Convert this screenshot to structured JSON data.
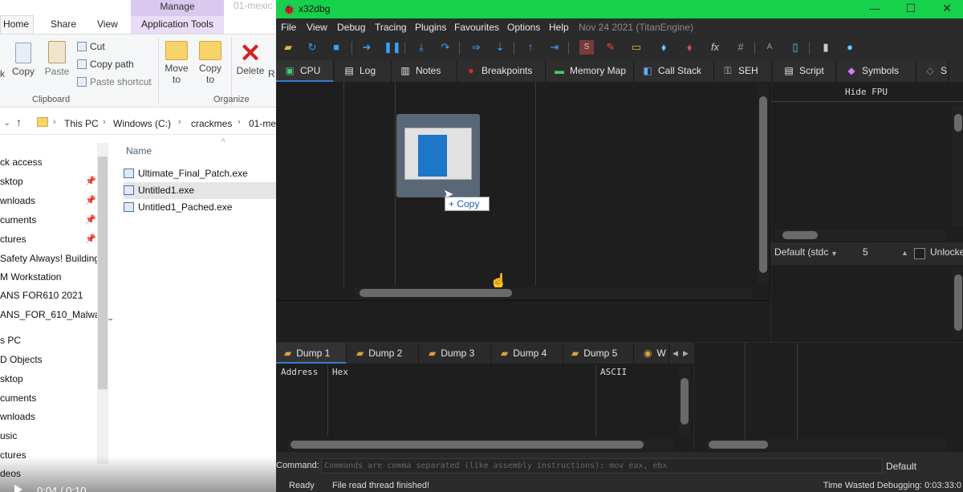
{
  "explorer": {
    "contextual_tab": "Manage",
    "path_peek": "01-mexic",
    "tabs": [
      "Home",
      "Share",
      "View",
      "Application Tools"
    ],
    "ribbon": {
      "pin_label": "k",
      "copy": "Copy",
      "paste": "Paste",
      "cut": "Cut",
      "copy_path": "Copy path",
      "paste_shortcut": "Paste shortcut",
      "move_to": "Move",
      "move_to_sub": "to",
      "copy_to": "Copy",
      "copy_to_sub": "to",
      "delete": "Delete",
      "rename": "R",
      "clipboard_group": "Clipboard",
      "organize_group": "Organize"
    },
    "breadcrumb": [
      "This PC",
      "Windows (C:)",
      "crackmes",
      "01-me"
    ],
    "nav": [
      "ck access",
      "sktop",
      "wnloads",
      "cuments",
      "ctures",
      "Safety Always! Building",
      "M Workstation",
      "ANS FOR610 2021",
      "ANS_FOR_610_Malware_",
      "s PC",
      "D Objects",
      "sktop",
      "cuments",
      "wnloads",
      "usic",
      "ctures",
      "deos"
    ],
    "column_name": "Name",
    "files": [
      "Ultimate_Final_Patch.exe",
      "Untitled1.exe",
      "Untitled1_Pached.exe"
    ],
    "video_time": "0:04 / 0:10"
  },
  "dbg": {
    "title": "x32dbg",
    "menus": [
      "File",
      "View",
      "Debug",
      "Tracing",
      "Plugins",
      "Favourites",
      "Options",
      "Help"
    ],
    "build": "Nov 24 2021 (TitanEngine)",
    "tabs": [
      "CPU",
      "Log",
      "Notes",
      "Breakpoints",
      "Memory Map",
      "Call Stack",
      "SEH",
      "Script",
      "Symbols",
      "S"
    ],
    "drag_tip": "Copy",
    "hide_fpu": "Hide FPU",
    "calling_convention": "Default (stdc",
    "arg_count": "5",
    "unlocked": "Unlocked",
    "dump_tabs": [
      "Dump 1",
      "Dump 2",
      "Dump 3",
      "Dump 4",
      "Dump 5",
      "W"
    ],
    "dump_headers": [
      "Address",
      "Hex",
      "ASCII"
    ],
    "command_label": "Command:",
    "command_placeholder": "Commands are comma separated (like assembly instructions): mov eax, ebx",
    "command_mode": "Default",
    "status_ready": "Ready",
    "status_message": "File read thread finished!",
    "status_time": "Time Wasted Debugging: 0:03:33:0"
  },
  "colors": {
    "titlebar": "#16d14b",
    "active_tab_accent": "#3a7bd5",
    "explorer_manage": "#d9c9ef"
  }
}
